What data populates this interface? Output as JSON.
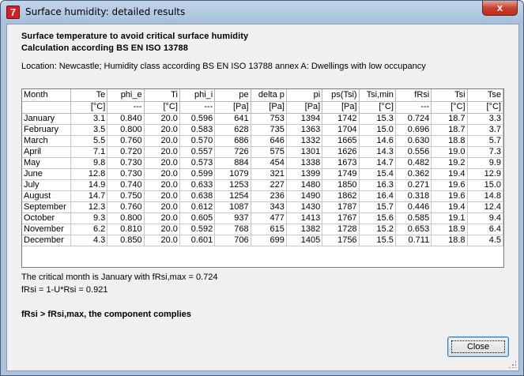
{
  "window": {
    "title": "Surface humidity: detailed results",
    "close_glyph": "x"
  },
  "report": {
    "heading1": "Surface temperature to avoid critical surface humidity",
    "heading2": "Calculation according BS EN ISO 13788",
    "location": "Location: Newcastle; Humidity class according BS EN ISO 13788 annex A: Dwellings with low occupancy"
  },
  "table": {
    "columns": [
      "Month",
      "Te",
      "phi_e",
      "Ti",
      "phi_i",
      "pe",
      "delta p",
      "pi",
      "ps(Tsi)",
      "Tsi,min",
      "fRsi",
      "Tsi",
      "Tse"
    ],
    "units": [
      "",
      "[°C]",
      "---",
      "[°C]",
      "---",
      "[Pa]",
      "[Pa]",
      "[Pa]",
      "[Pa]",
      "[°C]",
      "---",
      "[°C]",
      "[°C]"
    ],
    "rows": [
      [
        "January",
        "3.1",
        "0.840",
        "20.0",
        "0.596",
        "641",
        "753",
        "1394",
        "1742",
        "15.3",
        "0.724",
        "18.7",
        "3.3"
      ],
      [
        "February",
        "3.5",
        "0.800",
        "20.0",
        "0.583",
        "628",
        "735",
        "1363",
        "1704",
        "15.0",
        "0.696",
        "18.7",
        "3.7"
      ],
      [
        "March",
        "5.5",
        "0.760",
        "20.0",
        "0.570",
        "686",
        "646",
        "1332",
        "1665",
        "14.6",
        "0.630",
        "18.8",
        "5.7"
      ],
      [
        "April",
        "7.1",
        "0.720",
        "20.0",
        "0.557",
        "726",
        "575",
        "1301",
        "1626",
        "14.3",
        "0.556",
        "19.0",
        "7.3"
      ],
      [
        "May",
        "9.8",
        "0.730",
        "20.0",
        "0.573",
        "884",
        "454",
        "1338",
        "1673",
        "14.7",
        "0.482",
        "19.2",
        "9.9"
      ],
      [
        "June",
        "12.8",
        "0.730",
        "20.0",
        "0.599",
        "1079",
        "321",
        "1399",
        "1749",
        "15.4",
        "0.362",
        "19.4",
        "12.9"
      ],
      [
        "July",
        "14.9",
        "0.740",
        "20.0",
        "0.633",
        "1253",
        "227",
        "1480",
        "1850",
        "16.3",
        "0.271",
        "19.6",
        "15.0"
      ],
      [
        "August",
        "14.7",
        "0.750",
        "20.0",
        "0.638",
        "1254",
        "236",
        "1490",
        "1862",
        "16.4",
        "0.318",
        "19.6",
        "14.8"
      ],
      [
        "September",
        "12.3",
        "0.760",
        "20.0",
        "0.612",
        "1087",
        "343",
        "1430",
        "1787",
        "15.7",
        "0.446",
        "19.4",
        "12.4"
      ],
      [
        "October",
        "9.3",
        "0.800",
        "20.0",
        "0.605",
        "937",
        "477",
        "1413",
        "1767",
        "15.6",
        "0.585",
        "19.1",
        "9.4"
      ],
      [
        "November",
        "6.2",
        "0.810",
        "20.0",
        "0.592",
        "768",
        "615",
        "1382",
        "1728",
        "15.2",
        "0.653",
        "18.9",
        "6.4"
      ],
      [
        "December",
        "4.3",
        "0.850",
        "20.0",
        "0.601",
        "706",
        "699",
        "1405",
        "1756",
        "15.5",
        "0.711",
        "18.8",
        "4.5"
      ]
    ]
  },
  "notes": {
    "critical_month": "The critical month is January with fRsi,max = 0.724",
    "frsi": "fRsi = 1-U*Rsi = 0.921",
    "verdict": "fRsi > fRsi,max, the component complies"
  },
  "buttons": {
    "close_label": "Close"
  }
}
